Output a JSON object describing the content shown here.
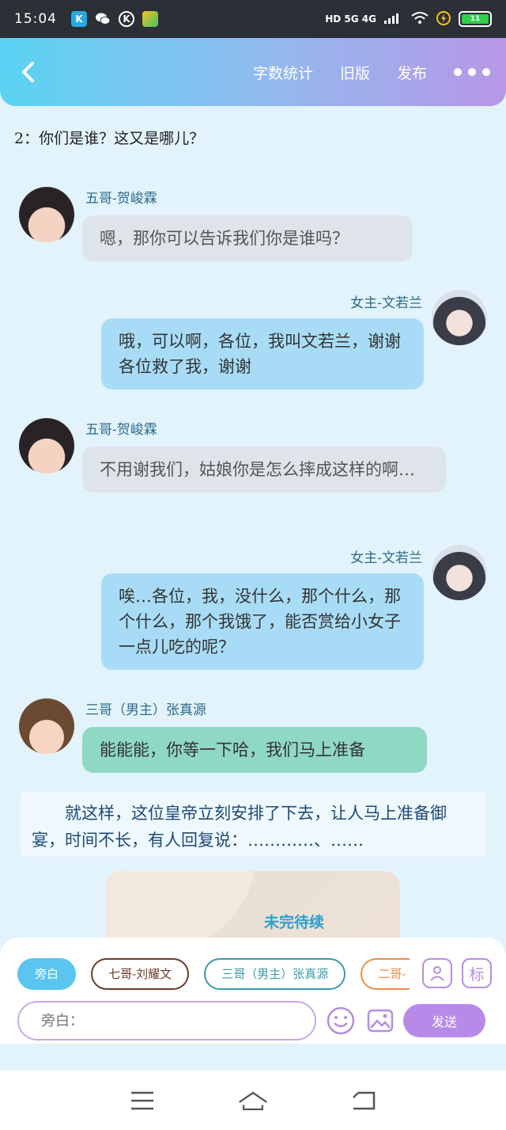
{
  "status_bar": {
    "time": "15:04",
    "network": "HD 5G 4G",
    "battery_level": "11"
  },
  "header": {
    "word_count_label": "字数统计",
    "old_version_label": "旧版",
    "publish_label": "发布"
  },
  "chat": {
    "question": "2：你们是谁？这又是哪儿？",
    "messages": [
      {
        "speaker": "五哥-贺峻霖",
        "text": "嗯，那你可以告诉我们你是谁吗？"
      },
      {
        "speaker": "女主-文若兰",
        "text": "哦，可以啊，各位，我叫文若兰，谢谢各位救了我，谢谢"
      },
      {
        "speaker": "五哥-贺峻霖",
        "text": "不用谢我们，姑娘你是怎么摔成这样的啊…"
      },
      {
        "speaker": "女主-文若兰",
        "text": "唉…各位，我，没什么，那个什么，那个什么，那个我饿了，能否赏给小女子一点儿吃的呢？"
      },
      {
        "speaker": "三哥（男主）张真源",
        "text": "能能能，你等一下哈，我们马上准备"
      }
    ],
    "narration": "就这样，这位皇帝立刻安排了下去，让人马上准备御宴，时间不长，有人回复说：…………、……",
    "card_text": "未完待续"
  },
  "composer": {
    "roles": [
      "旁白",
      "七哥-刘耀文",
      "三哥（男主）张真源",
      "二哥-"
    ],
    "mark_label": "标",
    "placeholder": "旁白：",
    "send_label": "发送"
  },
  "colors": {
    "header_gradient_start": "#5ad3f3",
    "header_gradient_end": "#b797e6",
    "accent_purple": "#b88ae8",
    "bubble_blue": "#a8dcf6",
    "bubble_gray": "#dfe4ea",
    "bubble_green": "#8fd8c4"
  }
}
